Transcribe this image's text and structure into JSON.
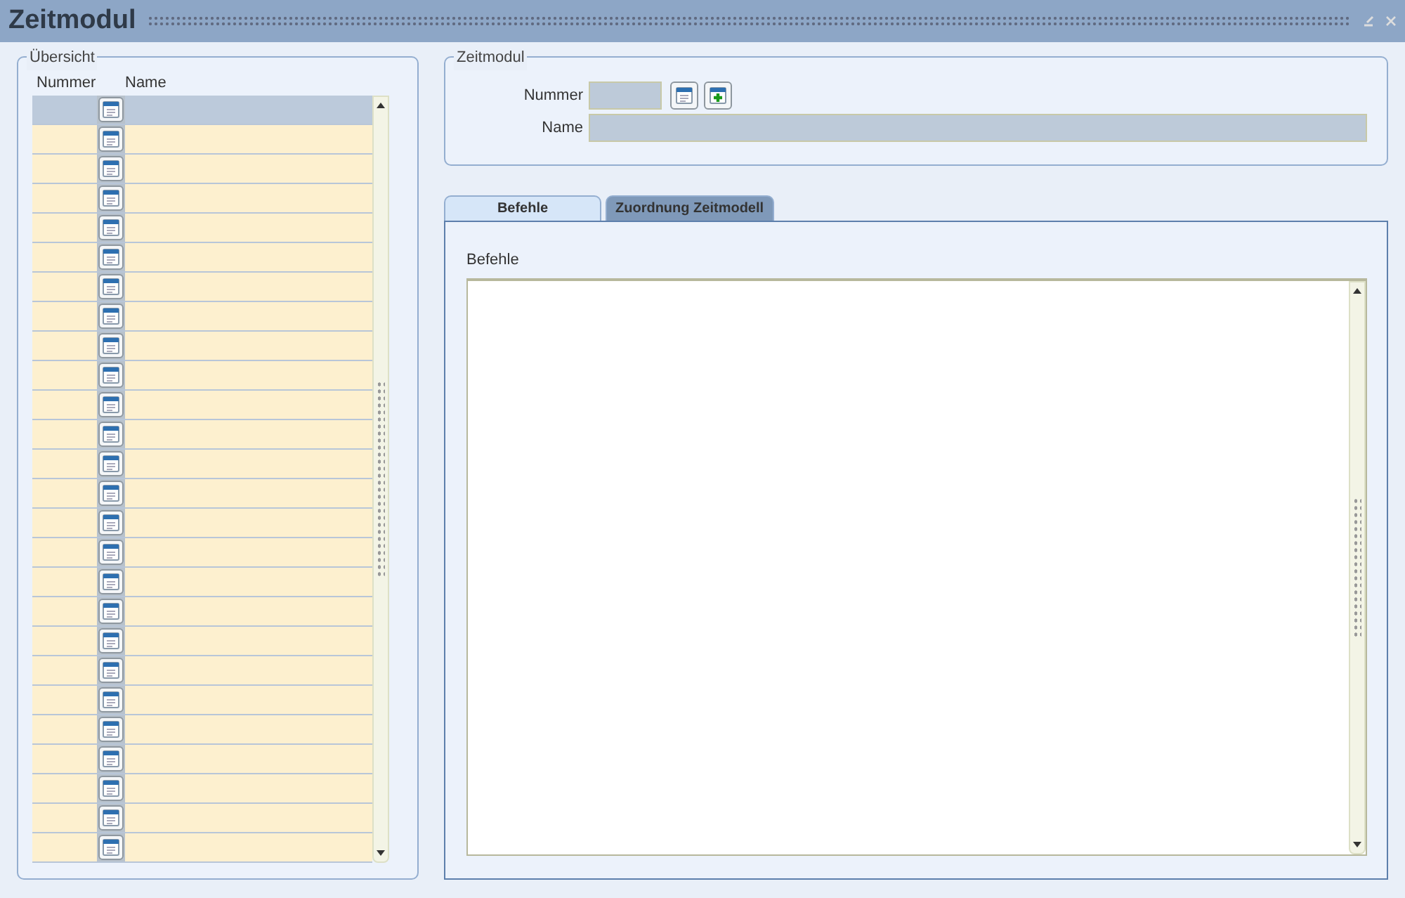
{
  "window": {
    "title": "Zeitmodul"
  },
  "overview": {
    "legend": "Übersicht",
    "columns": [
      "Nummer",
      "Name"
    ],
    "rows": [
      {
        "selected": true
      },
      {
        "selected": false
      },
      {
        "selected": false
      },
      {
        "selected": false
      },
      {
        "selected": false
      },
      {
        "selected": false
      },
      {
        "selected": false
      },
      {
        "selected": false
      },
      {
        "selected": false
      },
      {
        "selected": false
      },
      {
        "selected": false
      },
      {
        "selected": false
      },
      {
        "selected": false
      },
      {
        "selected": false
      },
      {
        "selected": false
      },
      {
        "selected": false
      },
      {
        "selected": false
      },
      {
        "selected": false
      },
      {
        "selected": false
      },
      {
        "selected": false
      },
      {
        "selected": false
      },
      {
        "selected": false
      },
      {
        "selected": false
      },
      {
        "selected": false
      },
      {
        "selected": false
      },
      {
        "selected": false
      }
    ]
  },
  "form": {
    "legend": "Zeitmodul",
    "fields": [
      {
        "label": "Nummer",
        "kind": "short"
      },
      {
        "label": "Name",
        "kind": "wide"
      }
    ]
  },
  "tabs": [
    {
      "label": "Befehle",
      "selected": true
    },
    {
      "label": "Zuordnung Zeitmodell",
      "selected": false
    }
  ],
  "panel": {
    "label": "Befehle"
  }
}
